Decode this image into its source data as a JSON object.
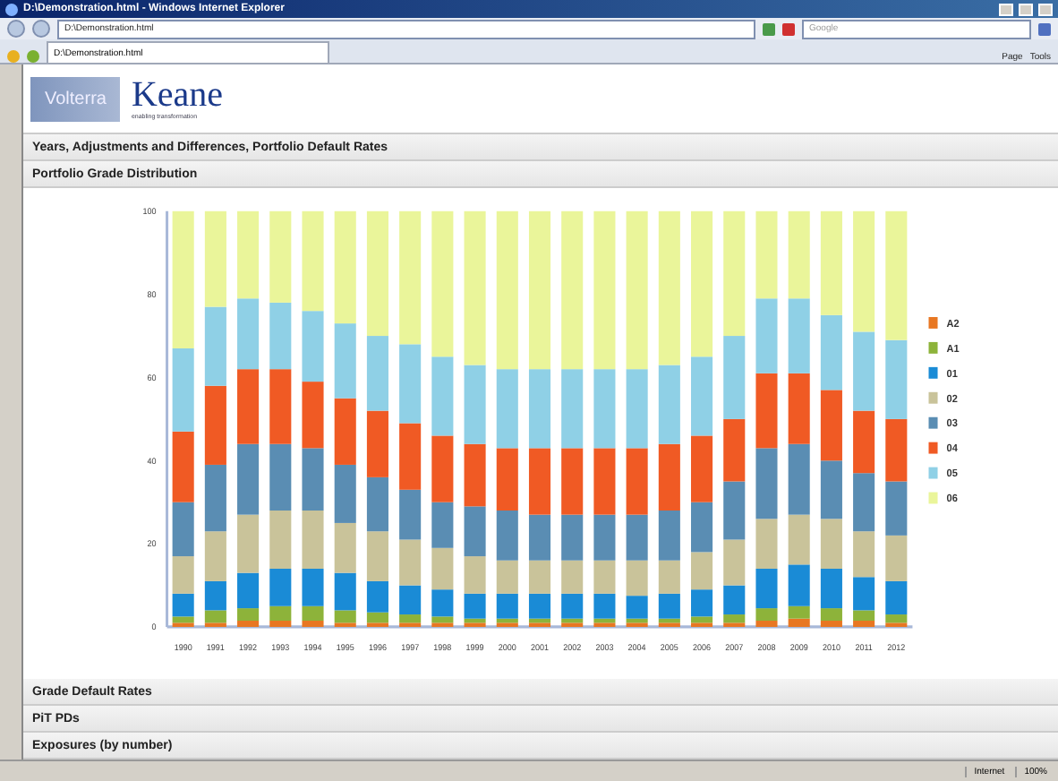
{
  "window": {
    "title": "D:\\Demonstration.html - Windows Internet Explorer"
  },
  "address_bar": {
    "value": "D:\\Demonstration.html",
    "search_placeholder": "Google"
  },
  "tabs": [
    {
      "label": "D:\\Demonstration.html",
      "selected": true
    }
  ],
  "command_bar": [
    "Page",
    "Tools"
  ],
  "logo": {
    "left": "Volterra",
    "brand": "Keane",
    "tagline": "enabling transformation"
  },
  "sections_top": [
    {
      "label": "Years, Adjustments and Differences, Portfolio Default Rates"
    },
    {
      "label": "Portfolio Grade Distribution"
    }
  ],
  "chart_data": {
    "type": "bar",
    "stacked": true,
    "legend": "right",
    "categories": [
      "1990",
      "1991",
      "1992",
      "1993",
      "1994",
      "1995",
      "1996",
      "1997",
      "1998",
      "1999",
      "2000",
      "2001",
      "2002",
      "2003",
      "2004",
      "2005",
      "2006",
      "2007",
      "2008",
      "2009",
      "2010",
      "2011",
      "2012"
    ],
    "ylim": [
      0,
      100
    ],
    "yticks": [
      0,
      20,
      40,
      60,
      80,
      100
    ],
    "series": [
      {
        "name": "A2",
        "color": "#e87722",
        "values": [
          1,
          1,
          1.5,
          1.5,
          1.5,
          1,
          1,
          1,
          1,
          1,
          1,
          1,
          1,
          1,
          1,
          1,
          1,
          1,
          1.5,
          2,
          1.5,
          1.5,
          1
        ]
      },
      {
        "name": "A1",
        "color": "#8db33a",
        "values": [
          1.5,
          3,
          3,
          3.5,
          3.5,
          3,
          2.5,
          2,
          1.5,
          1,
          1,
          1,
          1,
          1,
          1,
          1,
          1.5,
          2,
          3,
          3,
          3,
          2.5,
          2
        ]
      },
      {
        "name": "01",
        "color": "#1a8bd6",
        "values": [
          5.5,
          7,
          8.5,
          9,
          9,
          9,
          7.5,
          7,
          6.5,
          6,
          6,
          6,
          6,
          6,
          5.5,
          6,
          6.5,
          7,
          9.5,
          10,
          9.5,
          8,
          8
        ]
      },
      {
        "name": "02",
        "color": "#c9c39a",
        "values": [
          9,
          12,
          14,
          14,
          14,
          12,
          12,
          11,
          10,
          9,
          8,
          8,
          8,
          8,
          8.5,
          8,
          9,
          11,
          12,
          12,
          12,
          11,
          11
        ]
      },
      {
        "name": "03",
        "color": "#5a8db3",
        "values": [
          13,
          16,
          17,
          16,
          15,
          14,
          13,
          12,
          11,
          12,
          12,
          11,
          11,
          11,
          11,
          12,
          12,
          14,
          17,
          17,
          14,
          14,
          13
        ]
      },
      {
        "name": "04",
        "color": "#f05a24",
        "values": [
          17,
          19,
          18,
          18,
          16,
          16,
          16,
          16,
          16,
          15,
          15,
          16,
          16,
          16,
          16,
          16,
          16,
          15,
          18,
          17,
          17,
          15,
          15
        ]
      },
      {
        "name": "05",
        "color": "#8fd0e6",
        "values": [
          20,
          19,
          17,
          16,
          17,
          18,
          18,
          19,
          19,
          19,
          19,
          19,
          19,
          19,
          19,
          19,
          19,
          20,
          18,
          18,
          18,
          19,
          19
        ]
      },
      {
        "name": "06",
        "color": "#eaf59a",
        "values": [
          33,
          23,
          21,
          22,
          24,
          27,
          30,
          32,
          35,
          37,
          38,
          38,
          38,
          38,
          38,
          37,
          35,
          30,
          21,
          21,
          25,
          29,
          31
        ]
      }
    ]
  },
  "sections_bottom": [
    {
      "label": "Grade Default Rates"
    },
    {
      "label": "PiT PDs"
    },
    {
      "label": "Exposures (by number)"
    }
  ],
  "status_bar": {
    "zone": "Internet",
    "zoom": "100%"
  }
}
